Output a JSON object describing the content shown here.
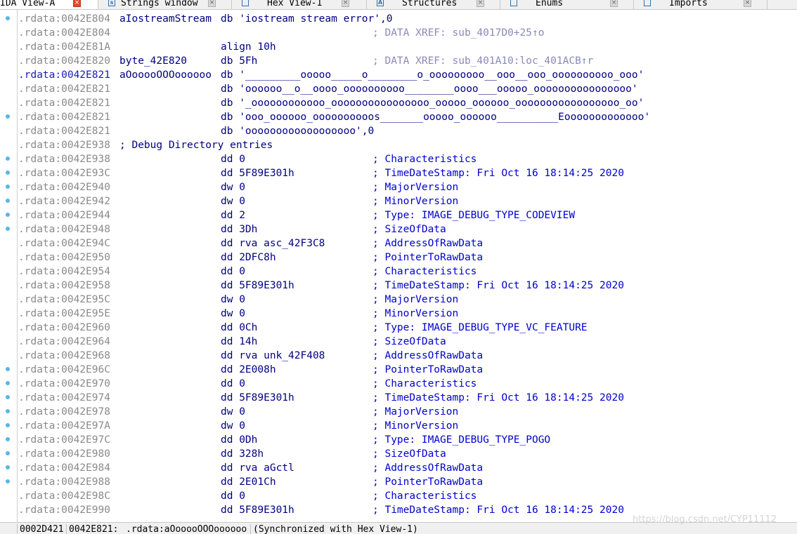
{
  "tabs": [
    {
      "label": "IDA View-A",
      "icon": "document-icon",
      "active": true
    },
    {
      "label": "Strings window",
      "icon": "strings-icon",
      "active": false
    },
    {
      "label": "Hex View-1",
      "icon": "hex-icon",
      "active": false
    },
    {
      "label": "Structures",
      "icon": "structures-icon",
      "active": false
    },
    {
      "label": "Enums",
      "icon": "enums-icon",
      "active": false
    },
    {
      "label": "Imports",
      "icon": "imports-icon",
      "active": false
    }
  ],
  "listing": [
    {
      "addr": ".rdata:0042E804",
      "label": "aIostreamStream",
      "op": "db 'iostream stream error',0",
      "cmt": "",
      "dot": true
    },
    {
      "addr": ".rdata:0042E804",
      "label": "",
      "op": "",
      "xref": "; DATA XREF: sub_4017D0+25↑o",
      "dot": false
    },
    {
      "addr": ".rdata:0042E81A",
      "label": "",
      "op": "align 10h",
      "cmt": "",
      "dot": false
    },
    {
      "addr": ".rdata:0042E820",
      "label": "byte_42E820",
      "op": "db 5Fh",
      "xref": "; DATA XREF: sub_401A10:loc_401ACB↑r",
      "dot": false
    },
    {
      "addr": ".rdata:0042E821",
      "label": "aOooooOOOoooooo",
      "op": "db '_________ooooo_____o________o_ooooooooo__ooo__ooo_oooooooooo_ooo'",
      "cmt": "",
      "dot": false,
      "hi": true
    },
    {
      "addr": ".rdata:0042E821",
      "label": "",
      "op": "db 'oooooo__o__oooo_oooooooooo________oooo___ooooo_oooooooooooooooo'",
      "cmt": "",
      "dot": false
    },
    {
      "addr": ".rdata:0042E821",
      "label": "",
      "op": "db '_oooooooooooo_oooooooooooooooo_ooooo_oooooo_ooooooooooooooooo_oo'",
      "cmt": "",
      "dot": false
    },
    {
      "addr": ".rdata:0042E821",
      "label": "",
      "op": "db 'ooo_oooooo_oooooooooos_______ooooo_oooooo__________Eooooooooooooo'",
      "cmt": "",
      "dot": true
    },
    {
      "addr": ".rdata:0042E821",
      "label": "",
      "op": "db 'oooooooooooooooooo',0",
      "cmt": "",
      "dot": false
    },
    {
      "addr": ".rdata:0042E938",
      "label": "; Debug Directory entries",
      "op": "",
      "cmt": "",
      "dot": false
    },
    {
      "addr": ".rdata:0042E938",
      "label": "",
      "op": "dd 0",
      "cmt": "; Characteristics",
      "dot": true
    },
    {
      "addr": ".rdata:0042E93C",
      "label": "",
      "op": "dd 5F89E301h",
      "cmt": "; TimeDateStamp: Fri Oct 16 18:14:25 2020",
      "dot": true
    },
    {
      "addr": ".rdata:0042E940",
      "label": "",
      "op": "dw 0",
      "cmt": "; MajorVersion",
      "dot": true
    },
    {
      "addr": ".rdata:0042E942",
      "label": "",
      "op": "dw 0",
      "cmt": "; MinorVersion",
      "dot": true
    },
    {
      "addr": ".rdata:0042E944",
      "label": "",
      "op": "dd 2",
      "cmt": "; Type: IMAGE_DEBUG_TYPE_CODEVIEW",
      "dot": true
    },
    {
      "addr": ".rdata:0042E948",
      "label": "",
      "op": "dd 3Dh",
      "cmt": "; SizeOfData",
      "dot": true
    },
    {
      "addr": ".rdata:0042E94C",
      "label": "",
      "op": "dd rva asc_42F3C8",
      "cmt": "; AddressOfRawData",
      "dot": false
    },
    {
      "addr": ".rdata:0042E950",
      "label": "",
      "op": "dd 2DFC8h",
      "cmt": "; PointerToRawData",
      "dot": false
    },
    {
      "addr": ".rdata:0042E954",
      "label": "",
      "op": "dd 0",
      "cmt": "; Characteristics",
      "dot": false
    },
    {
      "addr": ".rdata:0042E958",
      "label": "",
      "op": "dd 5F89E301h",
      "cmt": "; TimeDateStamp: Fri Oct 16 18:14:25 2020",
      "dot": false
    },
    {
      "addr": ".rdata:0042E95C",
      "label": "",
      "op": "dw 0",
      "cmt": "; MajorVersion",
      "dot": false
    },
    {
      "addr": ".rdata:0042E95E",
      "label": "",
      "op": "dw 0",
      "cmt": "; MinorVersion",
      "dot": false
    },
    {
      "addr": ".rdata:0042E960",
      "label": "",
      "op": "dd 0Ch",
      "cmt": "; Type: IMAGE_DEBUG_TYPE_VC_FEATURE",
      "dot": false
    },
    {
      "addr": ".rdata:0042E964",
      "label": "",
      "op": "dd 14h",
      "cmt": "; SizeOfData",
      "dot": false
    },
    {
      "addr": ".rdata:0042E968",
      "label": "",
      "op": "dd rva unk_42F408",
      "cmt": "; AddressOfRawData",
      "dot": false
    },
    {
      "addr": ".rdata:0042E96C",
      "label": "",
      "op": "dd 2E008h",
      "cmt": "; PointerToRawData",
      "dot": true
    },
    {
      "addr": ".rdata:0042E970",
      "label": "",
      "op": "dd 0",
      "cmt": "; Characteristics",
      "dot": true
    },
    {
      "addr": ".rdata:0042E974",
      "label": "",
      "op": "dd 5F89E301h",
      "cmt": "; TimeDateStamp: Fri Oct 16 18:14:25 2020",
      "dot": true
    },
    {
      "addr": ".rdata:0042E978",
      "label": "",
      "op": "dw 0",
      "cmt": "; MajorVersion",
      "dot": true
    },
    {
      "addr": ".rdata:0042E97A",
      "label": "",
      "op": "dw 0",
      "cmt": "; MinorVersion",
      "dot": true
    },
    {
      "addr": ".rdata:0042E97C",
      "label": "",
      "op": "dd 0Dh",
      "cmt": "; Type: IMAGE_DEBUG_TYPE_POGO",
      "dot": true
    },
    {
      "addr": ".rdata:0042E980",
      "label": "",
      "op": "dd 328h",
      "cmt": "; SizeOfData",
      "dot": true
    },
    {
      "addr": ".rdata:0042E984",
      "label": "",
      "op": "dd rva aGctl",
      "cmt": "; AddressOfRawData",
      "dot": true
    },
    {
      "addr": ".rdata:0042E988",
      "label": "",
      "op": "dd 2E01Ch",
      "cmt": "; PointerToRawData",
      "dot": true
    },
    {
      "addr": ".rdata:0042E98C",
      "label": "",
      "op": "dd 0",
      "cmt": "; Characteristics",
      "dot": false
    },
    {
      "addr": ".rdata:0042E990",
      "label": "",
      "op": "dd 5F89E301h",
      "cmt": "; TimeDateStamp: Fri Oct 16 18:14:25 2020",
      "dot": false
    }
  ],
  "status": {
    "offset": "0002D421",
    "address": "0042E821:",
    "location": ".rdata:aOooooOOOoooooo",
    "sync": "(Synchronized with Hex View-1)"
  },
  "watermark": "https://blog.csdn.net/CYP11112",
  "colors": {
    "address": "#8a8a8a",
    "address_highlight": "#1a1ab8",
    "opcode": "#000080",
    "comment": "#0000d0",
    "xref": "#8a8ab8",
    "gutter_dot": "#56b6e8",
    "close_active": "#e0492a"
  }
}
